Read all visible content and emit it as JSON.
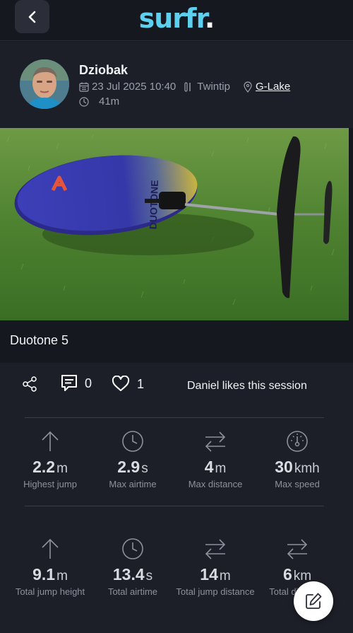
{
  "app": {
    "brand_word": "surfr",
    "brand_dot": ".",
    "colors": {
      "brand": "#5ed0ef",
      "background": "#16181f",
      "panel": "#1c1f27"
    }
  },
  "header": {
    "back_icon": "chevron-left-icon"
  },
  "session": {
    "user_name": "Dziobak",
    "date": "23 Jul 2025 10:40",
    "board_type": "Twintip",
    "spot": "G-Lake",
    "duration": "41m",
    "title": "Duotone 5",
    "photo_board_text": "DUOTONE"
  },
  "actions": {
    "share_icon": "share-icon",
    "comments_icon": "comment-icon",
    "comments_count": "0",
    "likes_icon": "heart-icon",
    "likes_count": "1",
    "likes_text": "Daniel likes this session"
  },
  "stats_top": [
    {
      "icon": "arrow-up-icon",
      "value": "2.2",
      "unit": "m",
      "label": "Highest jump"
    },
    {
      "icon": "clock-icon",
      "value": "2.9",
      "unit": "s",
      "label": "Max airtime"
    },
    {
      "icon": "swap-arrows-icon",
      "value": "4",
      "unit": "m",
      "label": "Max distance"
    },
    {
      "icon": "speedometer-icon",
      "value": "30",
      "unit": "kmh",
      "label": "Max speed"
    }
  ],
  "stats_bottom": [
    {
      "icon": "arrow-up-icon",
      "value": "9.1",
      "unit": "m",
      "label": "Total jump height"
    },
    {
      "icon": "clock-icon",
      "value": "13.4",
      "unit": "s",
      "label": "Total airtime"
    },
    {
      "icon": "swap-arrows-icon",
      "value": "14",
      "unit": "m",
      "label": "Total jump distance"
    },
    {
      "icon": "swap-arrows-icon",
      "value": "6",
      "unit": "km",
      "label": "Total distance"
    }
  ],
  "fab": {
    "icon": "edit-icon"
  }
}
